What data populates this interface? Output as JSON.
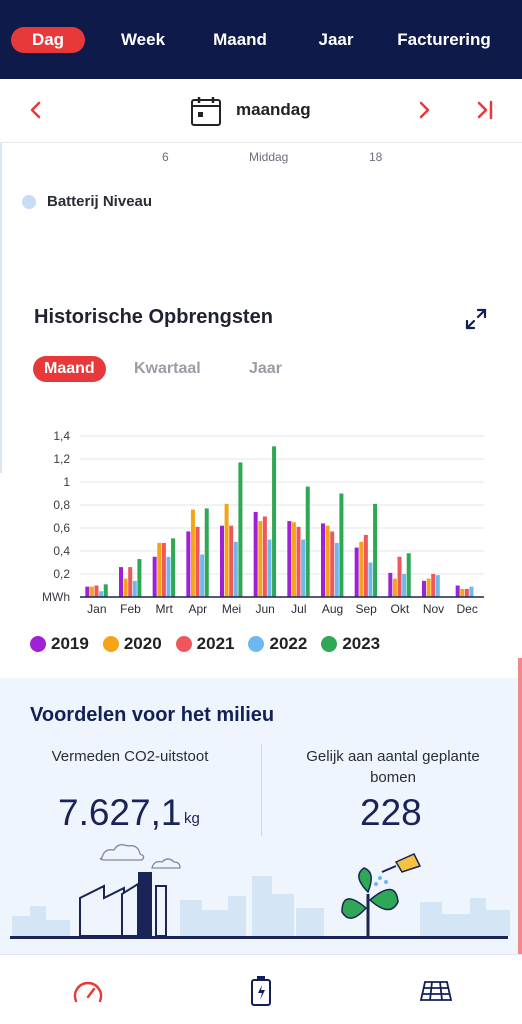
{
  "nav": {
    "tabs": [
      {
        "label": "Dag",
        "active": true
      },
      {
        "label": "Week",
        "active": false
      },
      {
        "label": "Maand",
        "active": false
      },
      {
        "label": "Jaar",
        "active": false
      },
      {
        "label": "Facturering",
        "active": false
      }
    ]
  },
  "datebar": {
    "day": "maandag",
    "prev_icon": "chevron-left-icon",
    "next_icon": "chevron-right-icon",
    "last_icon": "skip-to-end-icon",
    "calendar_icon": "calendar-icon"
  },
  "day_axis": {
    "ticks": [
      "6",
      "Middag",
      "18"
    ]
  },
  "battery_legend": {
    "label": "Batterij Niveau",
    "color": "#c8dcf6"
  },
  "historic": {
    "title": "Historische Opbrengsten",
    "expand_icon": "expand-icon",
    "segments": [
      {
        "label": "Maand",
        "active": true
      },
      {
        "label": "Kwartaal",
        "active": false
      },
      {
        "label": "Jaar",
        "active": false
      }
    ]
  },
  "chart_data": {
    "type": "bar",
    "categories": [
      "Jan",
      "Feb",
      "Mrt",
      "Apr",
      "Mei",
      "Jun",
      "Jul",
      "Aug",
      "Sep",
      "Okt",
      "Nov",
      "Dec"
    ],
    "ylabel": "MWh",
    "ylim": [
      0,
      1.4
    ],
    "yticks": [
      "0,2",
      "0,4",
      "0,6",
      "0,8",
      "1",
      "1,2",
      "1,4"
    ],
    "grid": true,
    "legend_placement": "bottom",
    "series": [
      {
        "name": "2019",
        "color": "#a020d8",
        "values": [
          0.09,
          0.26,
          0.35,
          0.57,
          0.62,
          0.74,
          0.66,
          0.64,
          0.43,
          0.21,
          0.14,
          0.1
        ]
      },
      {
        "name": "2020",
        "color": "#f5a416",
        "values": [
          0.09,
          0.16,
          0.47,
          0.76,
          0.81,
          0.66,
          0.65,
          0.62,
          0.48,
          0.16,
          0.16,
          0.07
        ]
      },
      {
        "name": "2021",
        "color": "#f0575a",
        "values": [
          0.1,
          0.26,
          0.47,
          0.61,
          0.62,
          0.7,
          0.61,
          0.57,
          0.54,
          0.35,
          0.2,
          0.07
        ]
      },
      {
        "name": "2022",
        "color": "#6db8ee",
        "values": [
          0.05,
          0.14,
          0.35,
          0.37,
          0.48,
          0.5,
          0.5,
          0.47,
          0.3,
          0.2,
          0.19,
          0.09
        ]
      },
      {
        "name": "2023",
        "color": "#2fa855",
        "values": [
          0.11,
          0.33,
          0.51,
          0.77,
          1.17,
          1.31,
          0.96,
          0.9,
          0.81,
          0.38,
          null,
          null
        ]
      }
    ]
  },
  "eco": {
    "title": "Voordelen voor het milieu",
    "co2_label": "Vermeden CO2-uitstoot",
    "co2_value": "7.627,1",
    "co2_unit": "kg",
    "trees_label_1": "Gelijk aan aantal geplante",
    "trees_label_2": "bomen",
    "trees_value": "228",
    "colors": {
      "accent": "#e8393a",
      "navy": "#0e1a4a",
      "panel": "#eef5fc"
    }
  },
  "bottom_nav": {
    "icons": [
      "speedometer-icon",
      "battery-charging-icon",
      "solar-panel-icon"
    ]
  }
}
